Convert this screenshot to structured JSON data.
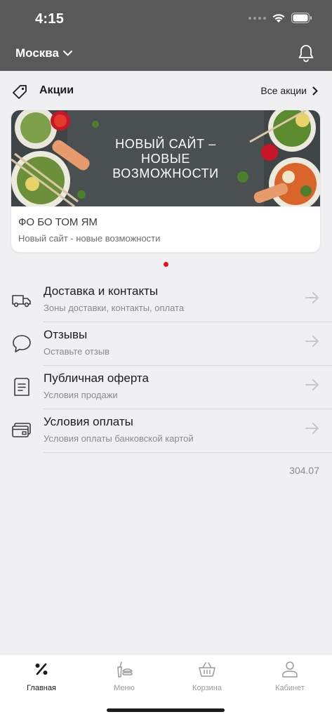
{
  "status": {
    "time": "4:15"
  },
  "header": {
    "city": "Москва"
  },
  "promo": {
    "title": "Акции",
    "all_label": "Все акции",
    "card": {
      "banner_line1": "НОВЫЙ САЙТ –",
      "banner_line2": "НОВЫЕ",
      "banner_line3": "ВОЗМОЖНОСТИ",
      "title": "ФО БО ТОМ ЯМ",
      "subtitle": "Новый сайт - новые возможности"
    }
  },
  "menu": [
    {
      "label": "Доставка и контакты",
      "sub": "Зоны доставки, контакты, оплата",
      "icon": "truck-icon"
    },
    {
      "label": "Отзывы",
      "sub": "Оставьте отзыв",
      "icon": "speech-bubble-icon"
    },
    {
      "label": "Публичная оферта",
      "sub": "Условия продажи",
      "icon": "document-icon"
    },
    {
      "label": "Условия оплаты",
      "sub": "Условия оплаты банковской картой",
      "icon": "credit-card-icon"
    }
  ],
  "version": "304.07",
  "tabs": [
    {
      "label": "Главная",
      "icon": "percent-icon",
      "active": true
    },
    {
      "label": "Меню",
      "icon": "food-icon",
      "active": false
    },
    {
      "label": "Корзина",
      "icon": "basket-icon",
      "active": false
    },
    {
      "label": "Кабинет",
      "icon": "user-icon",
      "active": false
    }
  ],
  "colors": {
    "header_bg": "#595959",
    "accent": "#e5101c",
    "page_bg": "#f0f0f2"
  }
}
